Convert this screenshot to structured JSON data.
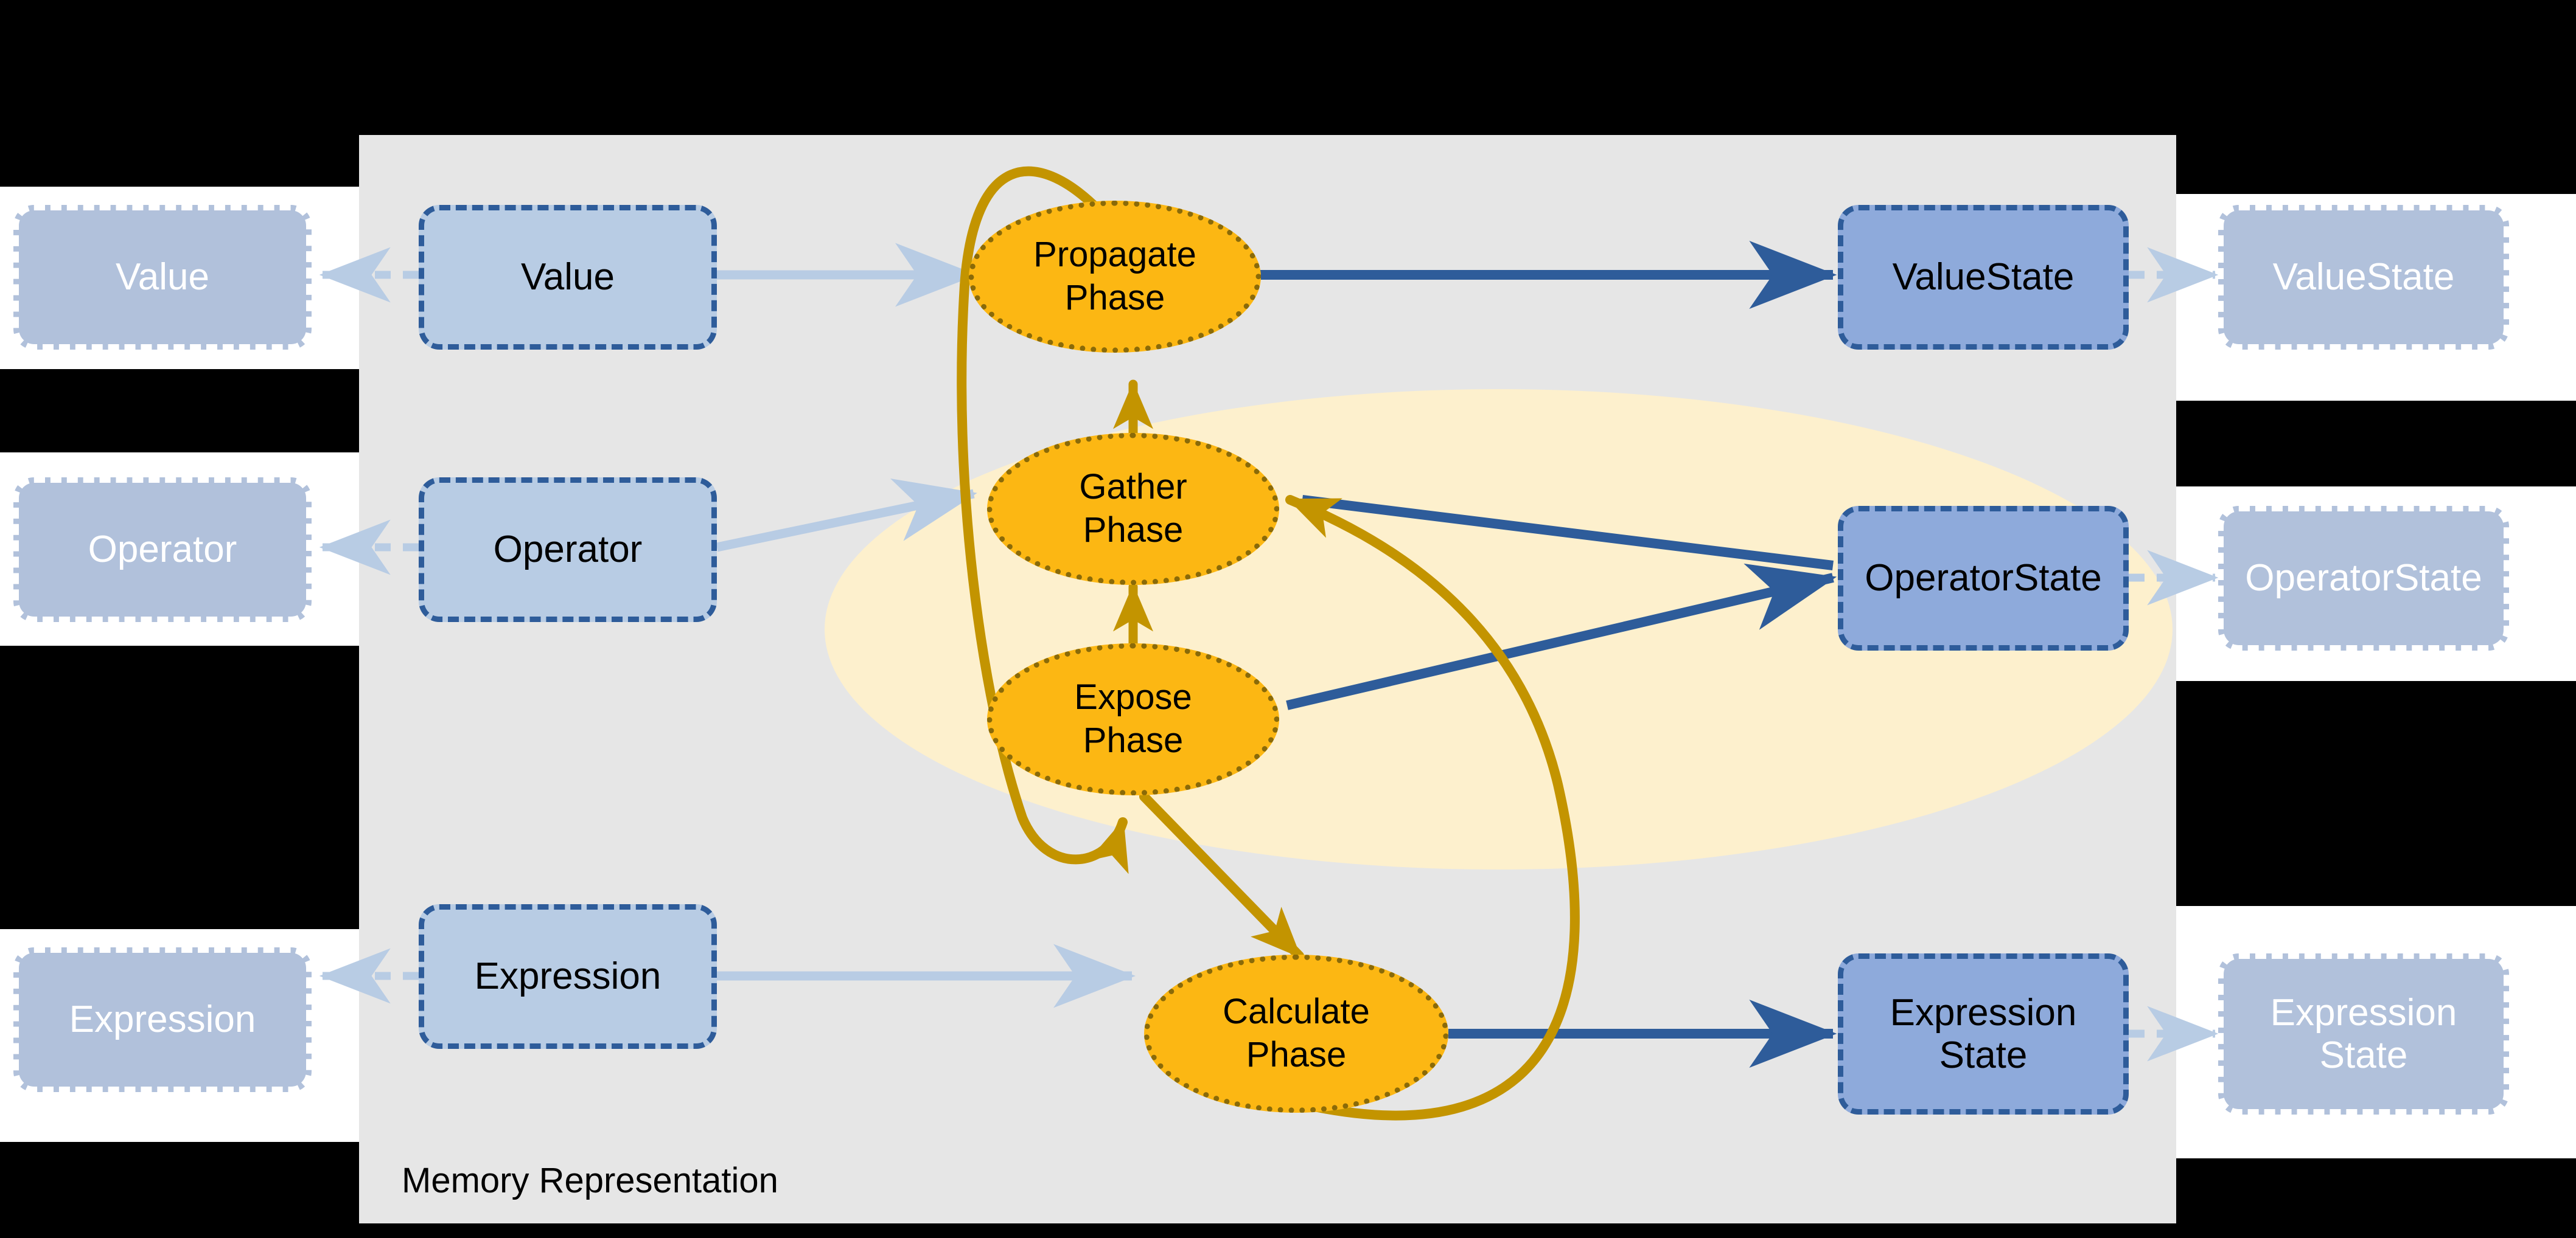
{
  "diagram": {
    "panel_label": "Memory Representation",
    "colors": {
      "panel_bg": "#e6e6e6",
      "halo": "#fdf0cd",
      "inner_box_fill": "#b8cce4",
      "state_box_fill": "#8eaadb",
      "ghost_box_fill": "#b1c1db",
      "box_border": "#2e5c9a",
      "phase_fill": "#fcb713",
      "phase_border": "#8a6a08",
      "arrow_dark_blue": "#2e5c9a",
      "arrow_light_blue": "#b8cce4",
      "arrow_gold": "#c39400",
      "canvas_bg": "#000000",
      "band_bg": "#ffffff"
    },
    "ghost_left": [
      {
        "id": "value",
        "label": "Value"
      },
      {
        "id": "operator",
        "label": "Operator"
      },
      {
        "id": "expression",
        "label": "Expression"
      }
    ],
    "inner_left": [
      {
        "id": "value",
        "label": "Value"
      },
      {
        "id": "operator",
        "label": "Operator"
      },
      {
        "id": "expression",
        "label": "Expression"
      }
    ],
    "phases": [
      {
        "id": "propagate",
        "line1": "Propagate",
        "line2": "Phase"
      },
      {
        "id": "gather",
        "line1": "Gather",
        "line2": "Phase"
      },
      {
        "id": "expose",
        "line1": "Expose",
        "line2": "Phase"
      },
      {
        "id": "calculate",
        "line1": "Calculate",
        "line2": "Phase"
      }
    ],
    "inner_right": [
      {
        "id": "value-state",
        "label": "ValueState",
        "line1": "ValueState",
        "line2": ""
      },
      {
        "id": "operator-state",
        "label": "OperatorState",
        "line1": "OperatorState",
        "line2": ""
      },
      {
        "id": "expression-state",
        "label": "Expression State",
        "line1": "Expression",
        "line2": "State"
      }
    ],
    "ghost_right": [
      {
        "id": "value-state",
        "label": "ValueState",
        "line1": "ValueState",
        "line2": ""
      },
      {
        "id": "operator-state",
        "label": "OperatorState",
        "line1": "OperatorState",
        "line2": ""
      },
      {
        "id": "expression-state",
        "label": "Expression State",
        "line1": "Expression",
        "line2": "State"
      }
    ]
  }
}
